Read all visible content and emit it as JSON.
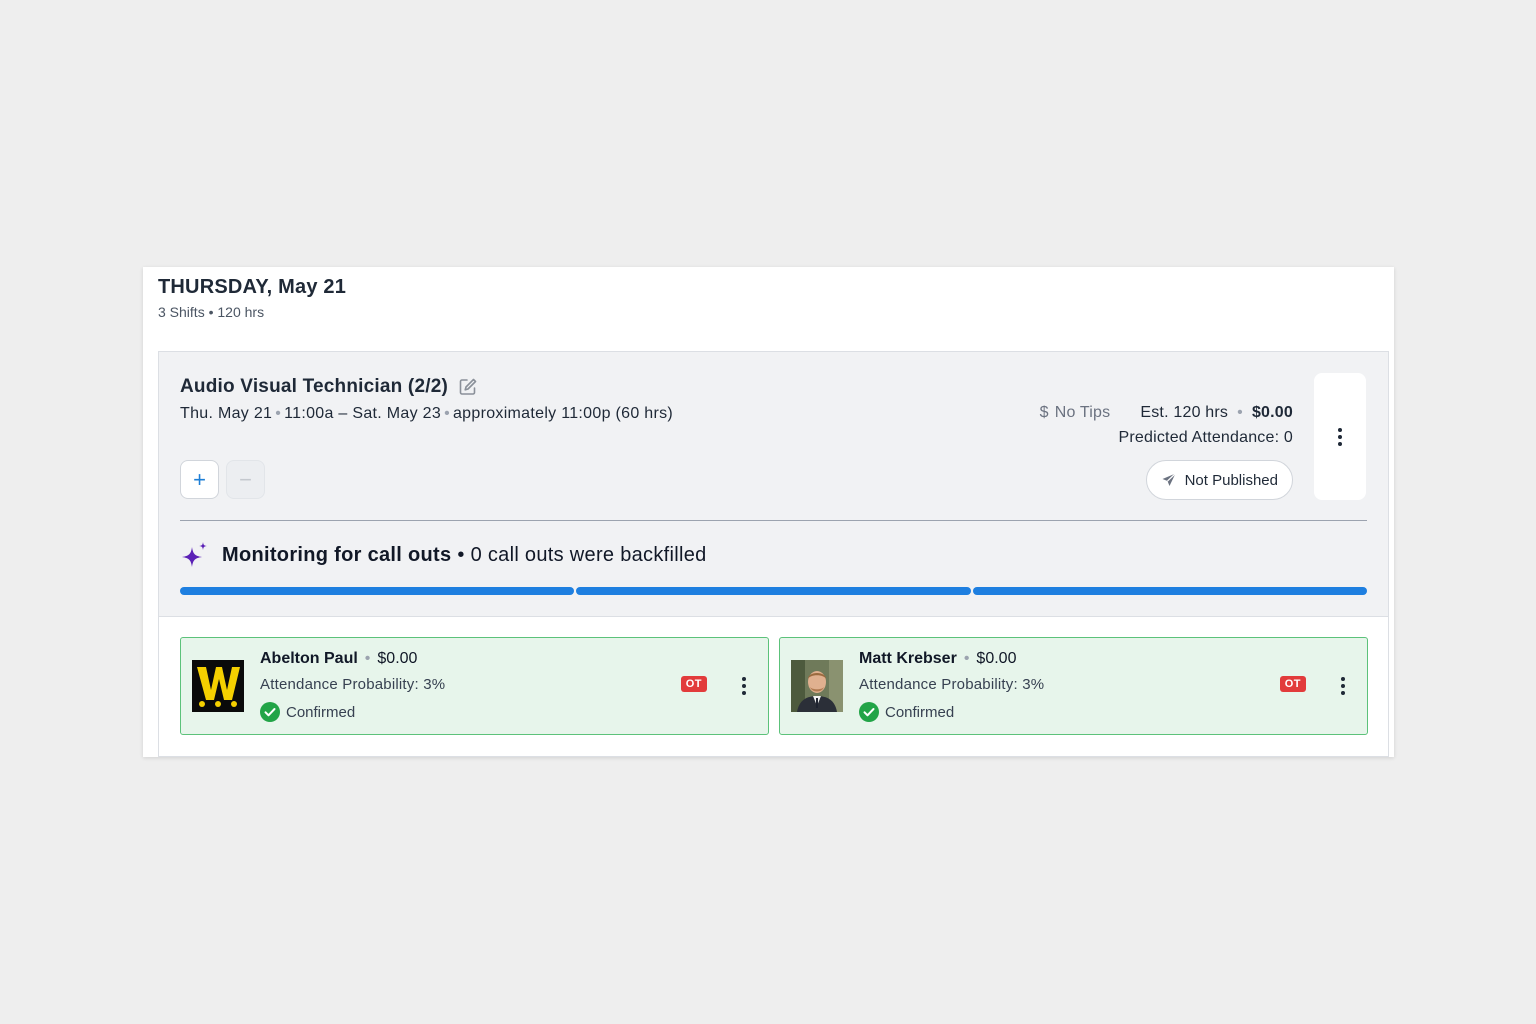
{
  "day": {
    "title": "THURSDAY, May 21",
    "summary": "3 Shifts • 120 hrs"
  },
  "shift": {
    "title": "Audio Visual Technician (2/2)",
    "start": "Thu. May 21",
    "time_range": "11:00a – Sat. May 23",
    "end_note": "approximately 11:00p (60 hrs)",
    "tips_symbol": "$",
    "tips_label": "No Tips",
    "est_hours": "Est. 120 hrs",
    "est_cost": "$0.00",
    "predicted_attendance": "Predicted Attendance: 0",
    "publish_status": "Not Published",
    "add_symbol": "+",
    "remove_symbol": "−"
  },
  "monitoring": {
    "bold": "Monitoring for call outs",
    "rest": "• 0 call outs were backfilled",
    "progress_segments": 3
  },
  "employees": [
    {
      "name": "Abelton Paul",
      "pay": "$0.00",
      "probability": "Attendance Probability: 3%",
      "status": "Confirmed",
      "badge": "OT",
      "avatar": "logo-avatar"
    },
    {
      "name": "Matt Krebser",
      "pay": "$0.00",
      "probability": "Attendance Probability: 3%",
      "status": "Confirmed",
      "badge": "OT",
      "avatar": "photo-avatar"
    }
  ],
  "colors": {
    "accent_blue": "#1e7fe0",
    "confirmed_green": "#22a447",
    "ot_red": "#e23b3b",
    "sparkle_purple": "#5b21b6"
  },
  "icons": {
    "edit": "edit-icon",
    "send": "send-icon",
    "sparkle": "sparkle-icon",
    "check": "check-circle-icon",
    "menu": "kebab-menu-icon"
  }
}
